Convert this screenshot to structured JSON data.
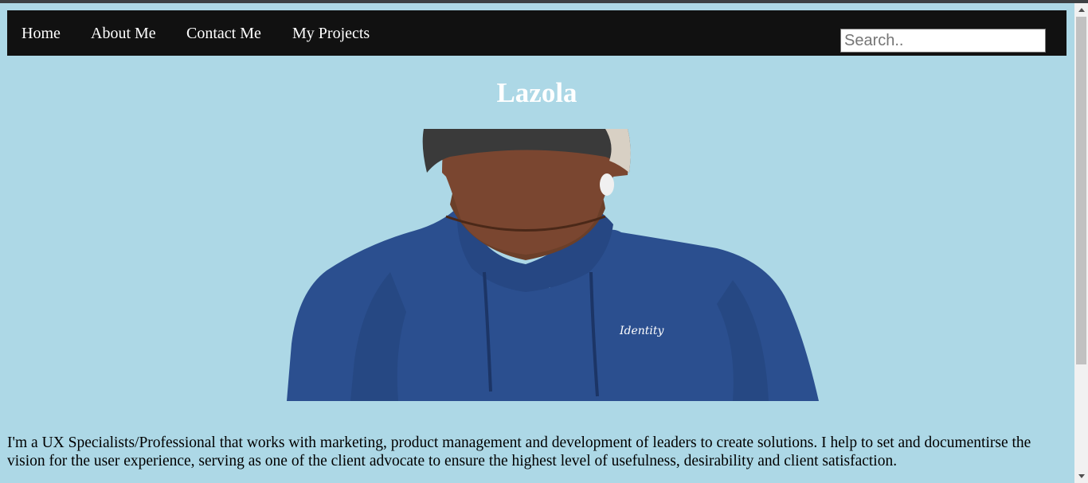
{
  "nav": {
    "home": "Home",
    "about": "About Me",
    "contact": "Contact Me",
    "projects": "My Projects"
  },
  "search": {
    "placeholder": "Search.."
  },
  "header": {
    "title": "Lazola"
  },
  "portrait": {
    "hoodie_text": "Identity"
  },
  "bio": {
    "text": "I'm a UX Specialists/Professional that works with marketing, product management and development of leaders to create solutions. I help to set and documentirse the vision for the user experience, serving as one of the client advocate to ensure the highest level of usefulness, desirability and client satisfaction."
  },
  "colors": {
    "background": "#add8e6",
    "nav_background": "#111111",
    "nav_text": "#ffffff",
    "title": "#ffffff"
  }
}
